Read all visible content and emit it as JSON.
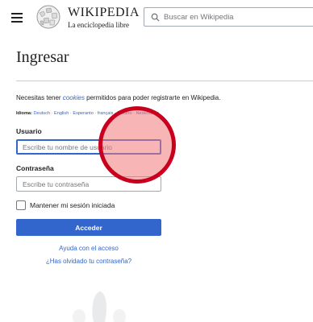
{
  "header": {
    "logo_name": "WIKIPEDIA",
    "logo_tagline": "La enciclopedia libre",
    "search_placeholder": "Buscar en Wikipedia"
  },
  "page": {
    "title": "Ingresar",
    "notice_prefix": "Necesitas tener ",
    "notice_link": "cookies",
    "notice_suffix": " permitidos para poder registrarte en Wikipedia."
  },
  "languages": {
    "label": "Idioma:",
    "items": [
      "Deutsch",
      "English",
      "Esperanto",
      "français",
      "Italiano",
      "Nederlands"
    ],
    "separator": "·"
  },
  "form": {
    "username_label": "Usuario",
    "username_placeholder": "Escribe tu nombre de usuario",
    "password_label": "Contraseña",
    "password_placeholder": "Escribe tu contraseña",
    "remember_label": "Mantener mi sesión iniciada",
    "remember_checked": false,
    "submit_label": "Acceder"
  },
  "links": {
    "help": "Ayuda con el acceso",
    "forgot": "¿Has olvidado tu contraseña?"
  },
  "colors": {
    "link": "#3366cc",
    "primary_button": "#3366cc",
    "touch_indicator": "#c8001e"
  }
}
